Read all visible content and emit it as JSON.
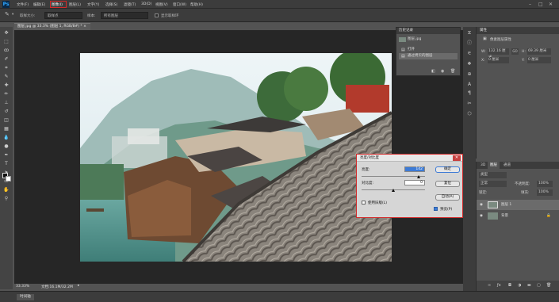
{
  "app": {
    "logo": "Ps"
  },
  "menu": [
    "文件(F)",
    "编辑(E)",
    "图像(I)",
    "图层(L)",
    "文字(Y)",
    "选择(S)",
    "滤镜(T)",
    "3D(D)",
    "视图(V)",
    "窗口(W)",
    "帮助(H)"
  ],
  "window_controls": {
    "min": "–",
    "max": "□",
    "close": "✕"
  },
  "options": {
    "sample_size_label": "取样大小:",
    "sample_size_value": "取样点",
    "sample_label": "样本:",
    "sample_value": "所有图层",
    "show_ring": "显示取样环"
  },
  "document": {
    "tab_title": "图层.jpg @ 33.3% (图层 1, RGB/8#) *",
    "tab_close": "×"
  },
  "status": {
    "zoom": "33.33%",
    "doc_info": "文档:16.1M/32.2M"
  },
  "bottom": {
    "timeline": "时间轴"
  },
  "history": {
    "title": "历史记录",
    "snapshot": "图层.jpg",
    "items": [
      "打开",
      "通过拷贝的图层"
    ]
  },
  "properties": {
    "title": "属性",
    "subtitle": "像素图层属性",
    "w_label": "W:",
    "w_value": "132.16 厘米",
    "link": "GO",
    "h_label": "H:",
    "h_value": "69.39 厘米",
    "x_label": "X:",
    "x_value": "0 厘米",
    "y_label": "Y:",
    "y_value": "0 厘米"
  },
  "layers": {
    "tabs": [
      "3D",
      "图层",
      "通道"
    ],
    "kind": "类型",
    "blend": "正常",
    "opacity_label": "不透明度:",
    "opacity": "100%",
    "lock_label": "锁定:",
    "fill_label": "填充:",
    "fill": "100%",
    "rows": [
      {
        "name": "图层 1"
      },
      {
        "name": "背景"
      }
    ]
  },
  "dialog": {
    "title": "亮度/对比度",
    "close": "✕",
    "brightness_label": "亮度:",
    "brightness_value": "142",
    "brightness_fraction": 0.9,
    "contrast_label": "对比度:",
    "contrast_value": "0",
    "contrast_fraction": 0.5,
    "ok": "确定",
    "reset": "复位",
    "auto": "自动(A)",
    "legacy": "使用旧版(L)",
    "preview": "预览(P)",
    "preview_checked": true
  },
  "colors": {
    "accent_red": "#d32a2a",
    "ui_dark": "#3c3c3c",
    "ui_mid": "#535353",
    "canvas": "#262626"
  }
}
